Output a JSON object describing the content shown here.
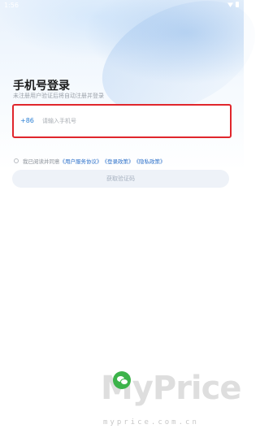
{
  "status_bar": {
    "time": "1:56"
  },
  "login": {
    "title": "手机号登录",
    "subtitle": "未注册用户验证后将自动注册并登录"
  },
  "phone": {
    "country_code": "+86",
    "placeholder": "请输入手机号"
  },
  "agreement": {
    "prefix": "我已阅读并同意",
    "links": [
      "《用户服务协议》",
      "《登录政策》",
      "《隐私政策》"
    ]
  },
  "get_code_button": {
    "label": "获取验证码"
  },
  "watermark": {
    "logo": "MyPrice",
    "url": "myprice.com.cn"
  },
  "colors": {
    "accent": "#2a7fd4",
    "highlight_border": "#e0262c",
    "disabled_button": "#eef2f8",
    "wechat_green": "#3cb34a"
  }
}
